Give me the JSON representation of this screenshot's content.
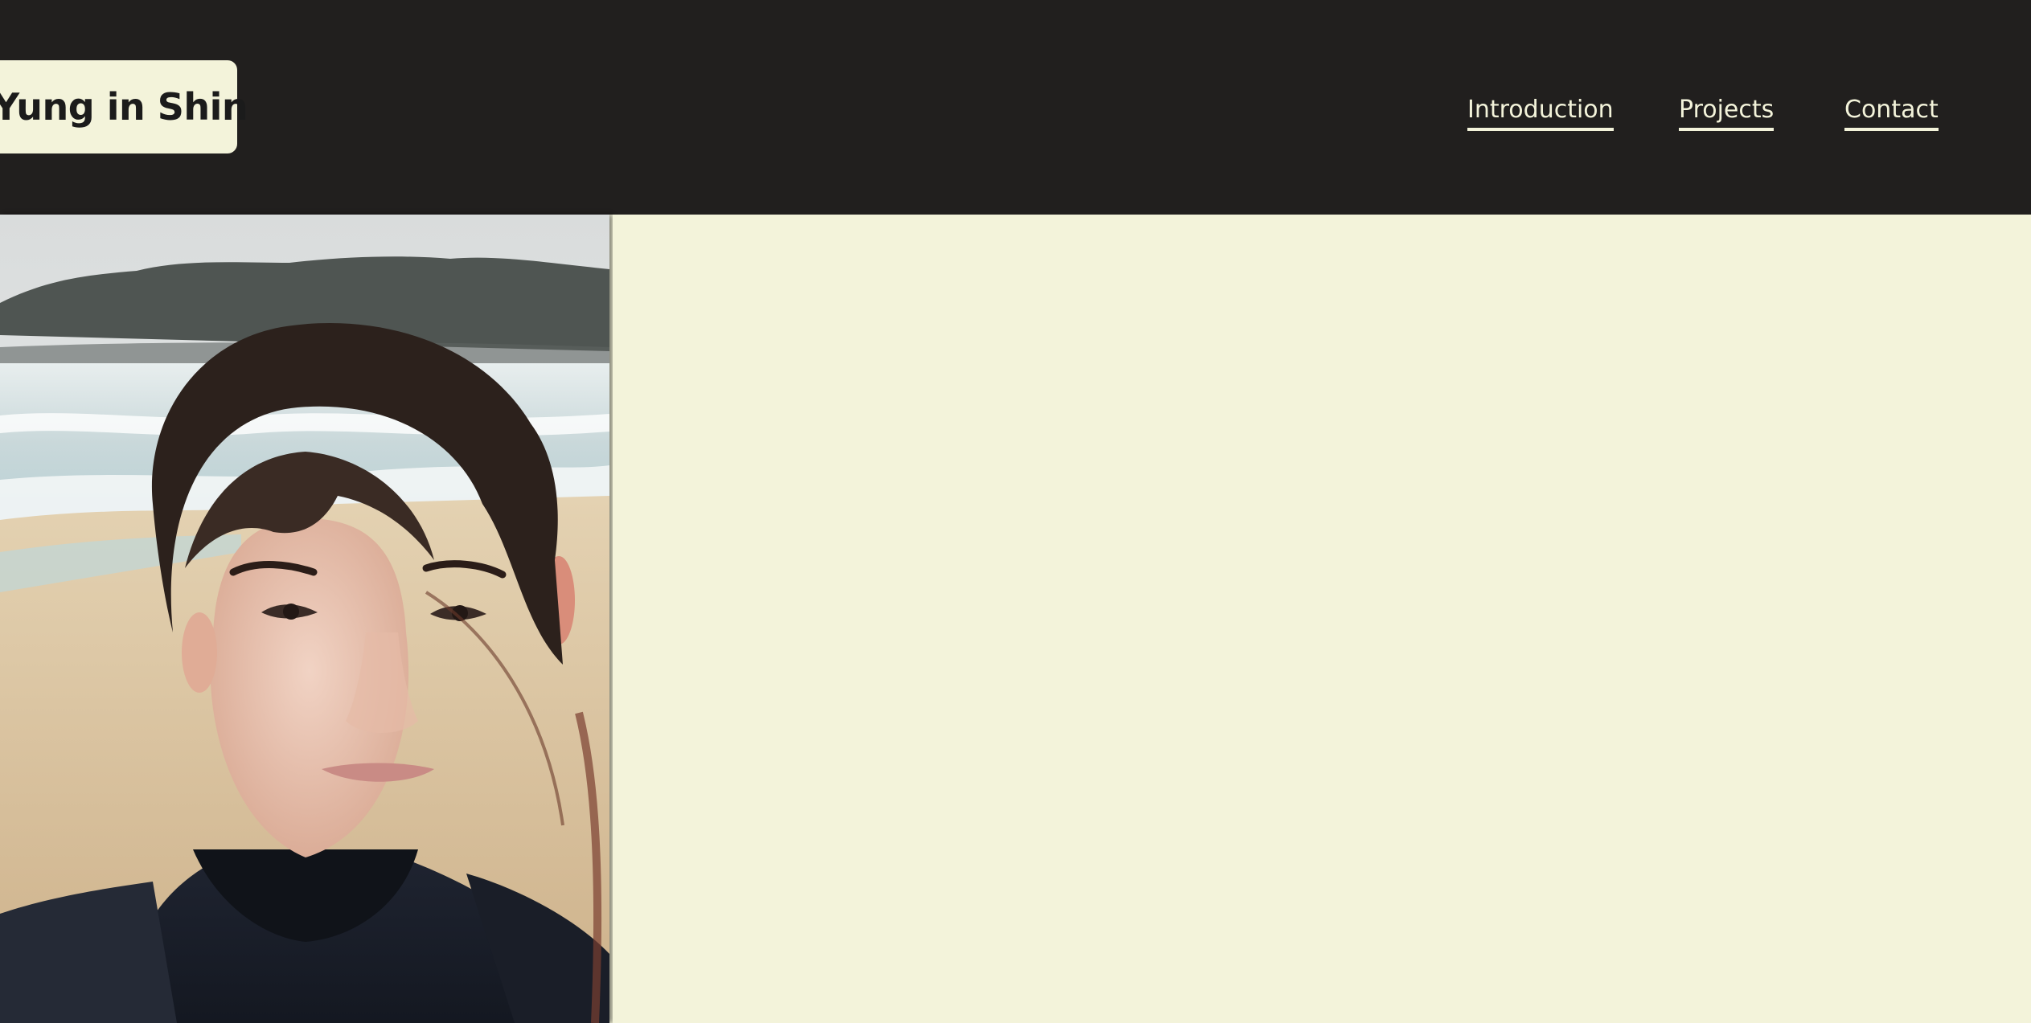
{
  "site": {
    "title": "Yung in Shin"
  },
  "nav": {
    "items": [
      {
        "label": "Introduction"
      },
      {
        "label": "Projects"
      },
      {
        "label": "Contact"
      }
    ]
  },
  "colors": {
    "header_bg": "#211f1e",
    "cream": "#f3f3da",
    "text_dark": "#1b1b1b"
  },
  "profile_photo": {
    "icon": "portrait-photo"
  }
}
